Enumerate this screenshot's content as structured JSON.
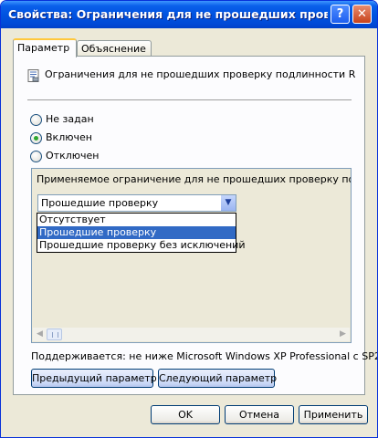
{
  "window": {
    "title": "Свойства: Ограничения для не прошедших прове..."
  },
  "titlebar_buttons": {
    "help": "?",
    "close": "✕"
  },
  "tabs": [
    {
      "label": "Параметр",
      "active": true
    },
    {
      "label": "Объяснение",
      "active": false
    }
  ],
  "policy": {
    "icon": "policy-sheet-icon",
    "name": "Ограничения для не прошедших проверку подлинности RPC-кли..."
  },
  "options": {
    "not_configured": "Не задан",
    "enabled": "Включен",
    "disabled": "Отключен",
    "selected": "enabled"
  },
  "setting": {
    "label": "Применяемое ограничение для не прошедших проверку подлинност",
    "combo_value": "Прошедшие проверку",
    "dropdown": [
      "Отсутствует",
      "Прошедшие проверку",
      "Прошедшие проверку без исключений"
    ],
    "highlighted_index": 1
  },
  "supported": "Поддерживается:  не ниже Microsoft Windows XP Professional с SP2",
  "nav": {
    "previous": "Предыдущий параметр",
    "next": "Следующий параметр"
  },
  "dialog_buttons": {
    "ok": "OK",
    "cancel": "Отмена",
    "apply": "Применить"
  },
  "colors": {
    "title_blue": "#0053e1",
    "selection": "#316ac5",
    "radio_dot": "#2ea62e",
    "tab_highlight": "#ffc83c"
  }
}
